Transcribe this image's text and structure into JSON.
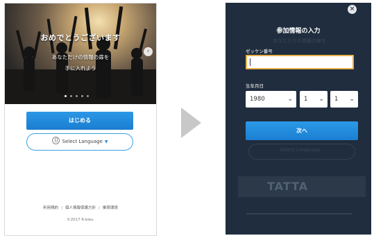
{
  "left_screen": {
    "hero": {
      "title": "おめでとうございます",
      "subtitle_line1": "あなただけの情報の扉を",
      "subtitle_line2": "手に入れよう",
      "next_arrow": "›",
      "dots_total": 5,
      "dots_active_index": 0
    },
    "start_button": "はじめる",
    "language_button": {
      "icon": "globe-icon",
      "label": "Select Language",
      "caret": "▼"
    },
    "footer": {
      "links": [
        "利用規約",
        "個人情報保護方針",
        "推奨環境"
      ],
      "copyright": "©2017 R-bies."
    }
  },
  "transition_arrow": "arrow-right",
  "right_screen": {
    "close_icon": "×",
    "modal_title": "参加情報の入力",
    "bib_label": "ゼッケン番号",
    "bib_value": "",
    "birthdate_label": "生年月日",
    "year": "1980",
    "month": "1",
    "day": "1",
    "next_button": "次へ",
    "background_ghost": {
      "subtitle": "あなただけの情報の扉を",
      "language": "Select Language",
      "logo": "TATTA"
    }
  },
  "colors": {
    "accent_blue": "#1f86d6",
    "modal_bg": "#1f2d3e",
    "input_focus_border": "#e8b04a"
  }
}
